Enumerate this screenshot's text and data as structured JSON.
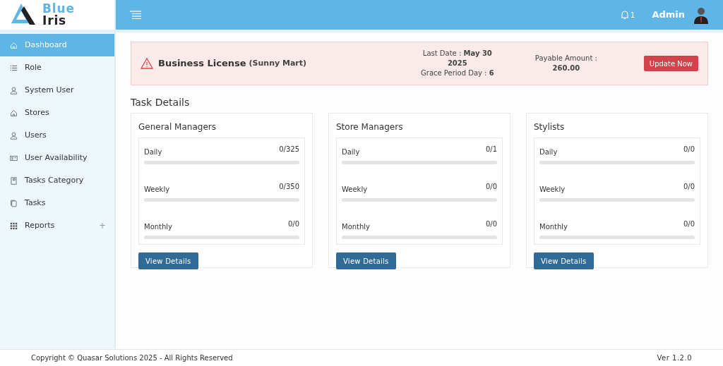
{
  "logo": {
    "line_1": "Blue",
    "line_2": "Iris"
  },
  "sidebar": {
    "items": [
      {
        "label": "Dashboard",
        "selected": true
      },
      {
        "label": "Role",
        "selected": false
      },
      {
        "label": "System User",
        "selected": false
      },
      {
        "label": "Stores",
        "selected": false
      },
      {
        "label": "Users",
        "selected": false
      },
      {
        "label": "User Availability",
        "selected": false
      },
      {
        "label": "Tasks Category",
        "selected": false
      },
      {
        "label": "Tasks",
        "selected": false
      },
      {
        "label": "Reports",
        "selected": false,
        "expander": "+"
      }
    ]
  },
  "header": {
    "notification_count": "1",
    "user": "Admin"
  },
  "alert": {
    "title": "Business License",
    "subtitle": "(Sunny Mart)",
    "last_date": "Last Date : **May 30 2025**",
    "grace_period": "Grace Period Day : **6**",
    "payable_label": "Payable Amount :",
    "payable_amount": "260.00",
    "button": "Update Now"
  },
  "task_details": {
    "title": "Task Details",
    "groups": [
      {
        "title": "General Managers",
        "rows": [
          {
            "label": "Daily",
            "count": "0/325",
            "level": 0
          },
          {
            "label": "Weekly",
            "count": "0/350",
            "level": 0
          },
          {
            "label": "Monthly",
            "count": "0/0",
            "level": 0
          }
        ],
        "button": "View Details"
      },
      {
        "title": "Store Managers",
        "rows": [
          {
            "label": "Daily",
            "count": "0/1",
            "level": 0
          },
          {
            "label": "Weekly",
            "count": "0/0",
            "level": 0
          },
          {
            "label": "Monthly",
            "count": "0/0",
            "level": 0
          }
        ],
        "button": "View Details"
      },
      {
        "title": "Stylists",
        "rows": [
          {
            "label": "Daily",
            "count": "0/0",
            "level": 0
          },
          {
            "label": "Weekly",
            "count": "0/0",
            "level": 0
          },
          {
            "label": "Monthly",
            "count": "0/0",
            "level": 0
          }
        ],
        "button": "View Details"
      }
    ]
  },
  "footer": {
    "copyright": "Copyright © Quasar Solutions 2025 - All Rights Reserved",
    "version": "Ver 1.2.0"
  }
}
